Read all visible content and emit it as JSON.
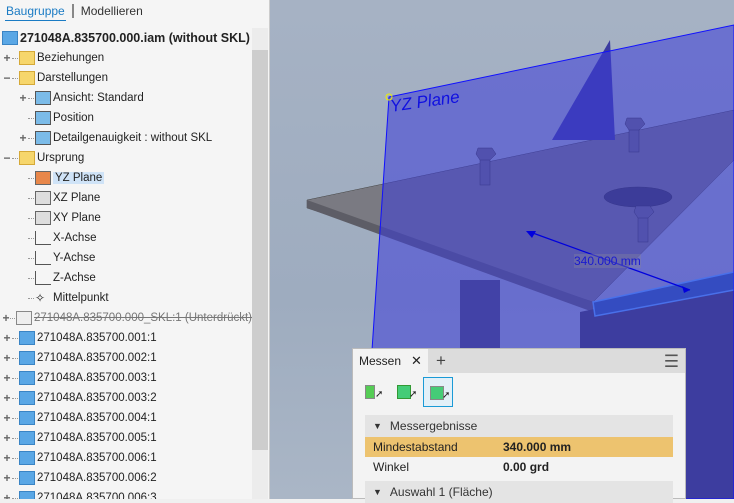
{
  "tabs": [
    "Baugruppe",
    "Modellieren"
  ],
  "tree": [
    {
      "label": "271048A.835700.000.iam (without SKL)",
      "icon": "assembly-icon",
      "level": 0,
      "exp": ""
    },
    {
      "label": "Beziehungen",
      "icon": "folder-icon",
      "level": 1,
      "exp": "+"
    },
    {
      "label": "Darstellungen",
      "icon": "representations-folder-icon",
      "level": 1,
      "exp": "−"
    },
    {
      "label": "Ansicht: Standard",
      "icon": "view-rep-icon",
      "level": 2,
      "exp": "+"
    },
    {
      "label": "Position",
      "icon": "position-icon",
      "level": 2,
      "exp": ""
    },
    {
      "label": "Detailgenauigkeit : without SKL",
      "icon": "lod-icon",
      "level": 2,
      "exp": "+"
    },
    {
      "label": "Ursprung",
      "icon": "open-folder-icon",
      "level": 1,
      "exp": "−"
    },
    {
      "label": "YZ Plane",
      "icon": "plane-icon",
      "level": 2,
      "exp": "",
      "selected": true
    },
    {
      "label": "XZ Plane",
      "icon": "plane-icon",
      "level": 2,
      "exp": ""
    },
    {
      "label": "XY Plane",
      "icon": "plane-icon",
      "level": 2,
      "exp": ""
    },
    {
      "label": "X-Achse",
      "icon": "axis-icon",
      "level": 2,
      "exp": ""
    },
    {
      "label": "Y-Achse",
      "icon": "axis-icon",
      "level": 2,
      "exp": ""
    },
    {
      "label": "Z-Achse",
      "icon": "axis-icon",
      "level": 2,
      "exp": ""
    },
    {
      "label": "Mittelpunkt",
      "icon": "point-icon",
      "level": 2,
      "exp": ""
    },
    {
      "label": "271048A.835700.000_SKL:1 (Unterdrückt)",
      "icon": "suppressed-part-icon",
      "level": 1,
      "exp": "+",
      "suppressed": true
    },
    {
      "label": "271048A.835700.001:1",
      "icon": "part-pinned-icon",
      "level": 1,
      "exp": "+"
    },
    {
      "label": "271048A.835700.002:1",
      "icon": "part-pinned-icon",
      "level": 1,
      "exp": "+"
    },
    {
      "label": "271048A.835700.003:1",
      "icon": "part-pinned-icon",
      "level": 1,
      "exp": "+"
    },
    {
      "label": "271048A.835700.003:2",
      "icon": "part-icon",
      "level": 1,
      "exp": "+"
    },
    {
      "label": "271048A.835700.004:1",
      "icon": "part-pinned-icon",
      "level": 1,
      "exp": "+"
    },
    {
      "label": "271048A.835700.005:1",
      "icon": "part-pinned-icon",
      "level": 1,
      "exp": "+"
    },
    {
      "label": "271048A.835700.006:1",
      "icon": "part-pinned-icon",
      "level": 1,
      "exp": "+"
    },
    {
      "label": "271048A.835700.006:2",
      "icon": "part-icon",
      "level": 1,
      "exp": "+"
    },
    {
      "label": "271048A.835700.006:3",
      "icon": "part-icon",
      "level": 1,
      "exp": "+"
    }
  ],
  "viewport": {
    "plane_label": "YZ Plane",
    "dimension": "340.000 mm"
  },
  "measure": {
    "tab": "Messen",
    "section1": "Messergebnisse",
    "rows": [
      {
        "label": "Mindestabstand",
        "value": "340.000 mm",
        "highlight": true
      },
      {
        "label": "Winkel",
        "value": "0.00 grd"
      }
    ],
    "section2": "Auswahl 1 (Fläche)"
  },
  "colors": {
    "accent": "#1a7bc4",
    "highlight": "#edc36f",
    "plane": "#5a5ad0"
  }
}
